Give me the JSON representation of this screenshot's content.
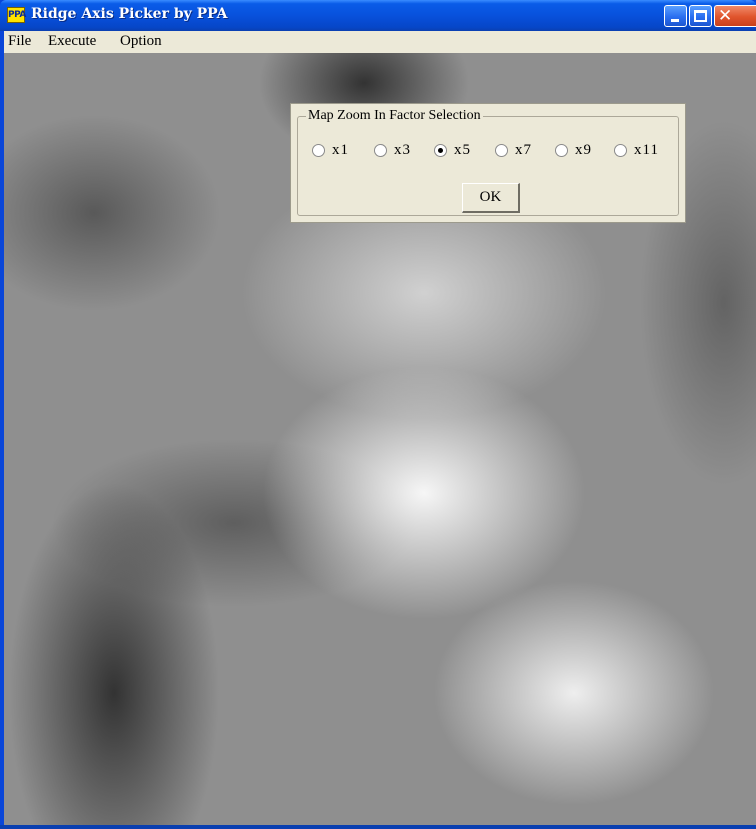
{
  "window": {
    "title": "Ridge Axis Picker by PPA",
    "app_icon_text": "PPA"
  },
  "menu": {
    "items": [
      "File",
      "Execute",
      "Option"
    ]
  },
  "dialog": {
    "group_title": "Map Zoom In Factor Selection",
    "options": [
      "x1",
      "x3",
      "x5",
      "x7",
      "x9",
      "x11"
    ],
    "selected": "x5",
    "ok_label": "OK"
  },
  "colors": {
    "title_bar": "#0a5ce8",
    "dialog_bg": "#ece9d8",
    "close_button": "#e0542c"
  }
}
